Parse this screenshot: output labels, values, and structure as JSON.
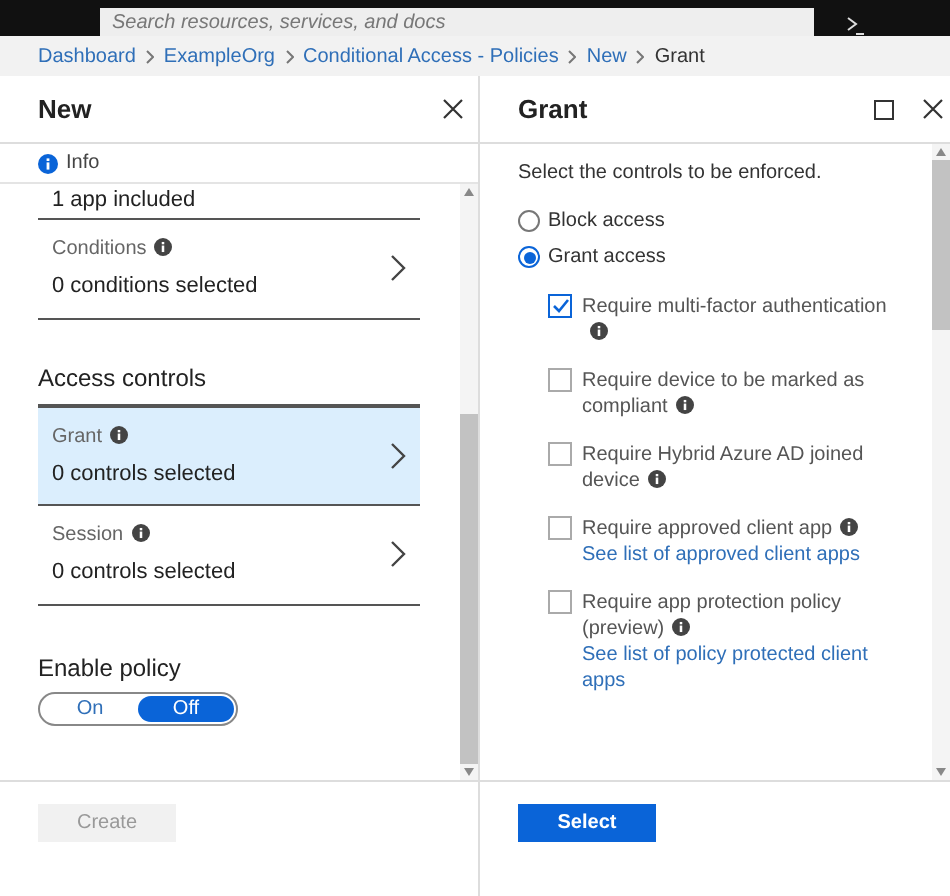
{
  "top_bar": {
    "search": {
      "placeholder": "Search resources, services, and docs"
    }
  },
  "breadcrumb": [
    {
      "label": "Dashboard",
      "link": true
    },
    {
      "label": "ExampleOrg",
      "link": true
    },
    {
      "label": "Conditional Access - Policies",
      "link": true
    },
    {
      "label": "New",
      "link": true
    },
    {
      "label": "Grant",
      "link": false
    }
  ],
  "left_panel": {
    "title": "New",
    "info": "Info",
    "partial_text": "1 app included",
    "items": [
      {
        "label": "Conditions",
        "value": "0 conditions selected",
        "selected": false
      }
    ],
    "section": "Access controls",
    "controls": [
      {
        "label": "Grant",
        "value": "0 controls selected",
        "selected": true
      },
      {
        "label": "Session",
        "value": "0 controls selected",
        "selected": false
      }
    ],
    "enable_policy": {
      "label": "Enable policy",
      "options": [
        {
          "label": "On",
          "selected": false
        },
        {
          "label": "Off",
          "selected": true
        }
      ]
    },
    "create_button": {
      "label": "Create",
      "disabled": true
    }
  },
  "right_panel": {
    "title": "Grant",
    "instruction": "Select the controls to be enforced.",
    "radios": [
      {
        "label": "Block access",
        "selected": false
      },
      {
        "label": "Grant access",
        "selected": true
      }
    ],
    "checks": [
      {
        "label": "Require multi-factor authentication",
        "checked": true
      },
      {
        "label": "Require device to be marked as compliant",
        "checked": false
      },
      {
        "label": "Require Hybrid Azure AD joined device",
        "checked": false
      },
      {
        "label": "Require approved client app",
        "checked": false,
        "link": "See list of approved client apps"
      },
      {
        "label": "Require app protection policy (preview)",
        "checked": false,
        "link": "See list of policy protected client apps"
      }
    ],
    "select_button": "Select"
  }
}
